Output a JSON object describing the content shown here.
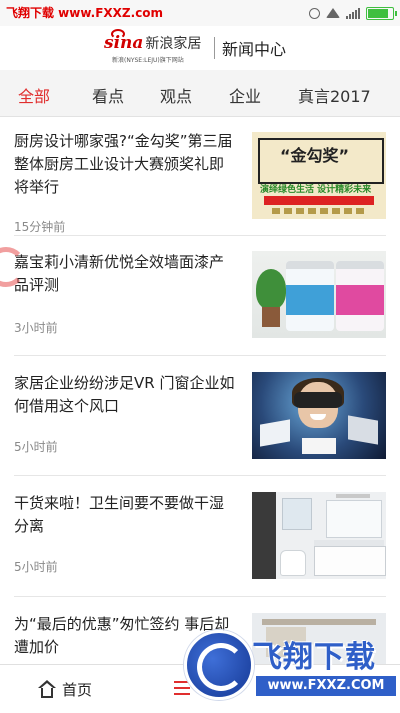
{
  "watermark_top": "飞翔下载 www.FXXZ.com",
  "status_bar": {
    "icons": [
      "alarm-icon",
      "wifi-icon",
      "signal-icon",
      "battery-icon"
    ]
  },
  "header": {
    "logo_main": "sina",
    "logo_sub": "新浪家居",
    "logo_small": "新浪(NYSE:LEJU)旗下网站",
    "title": "新闻中心"
  },
  "tabs": [
    {
      "label": "全部",
      "active": true
    },
    {
      "label": "看点",
      "active": false
    },
    {
      "label": "观点",
      "active": false
    },
    {
      "label": "企业",
      "active": false
    },
    {
      "label": "真言2017",
      "active": false
    }
  ],
  "news": [
    {
      "title": "厨房设计哪家强?“金勾奖”第三届整体厨房工业设计大赛颁奖礼即将举行",
      "time": "15分钟前",
      "thumb_text": "“金勾奖”",
      "thumb_sub1": "演绎绿色生活 设计精彩未来"
    },
    {
      "title": "嘉宝莉小清新优悦全效墙面漆产品评测",
      "time": "3小时前"
    },
    {
      "title": "家居企业纷纷涉足VR 门窗企业如何借用这个风口",
      "time": "5小时前"
    },
    {
      "title": "干货来啦！卫生间要不要做干湿分离",
      "time": "5小时前"
    },
    {
      "title": "为“最后的优惠”匆忙签约 事后却遭加价",
      "time": ""
    }
  ],
  "bottom_nav": {
    "home_label": "首页"
  },
  "overlay": {
    "brand": "飞翔下载",
    "url": "www.FXXZ.COM"
  },
  "colors": {
    "accent": "#e02e2e",
    "brand_blue": "#2f5fc8",
    "tab_bg": "#f4f4f4"
  }
}
